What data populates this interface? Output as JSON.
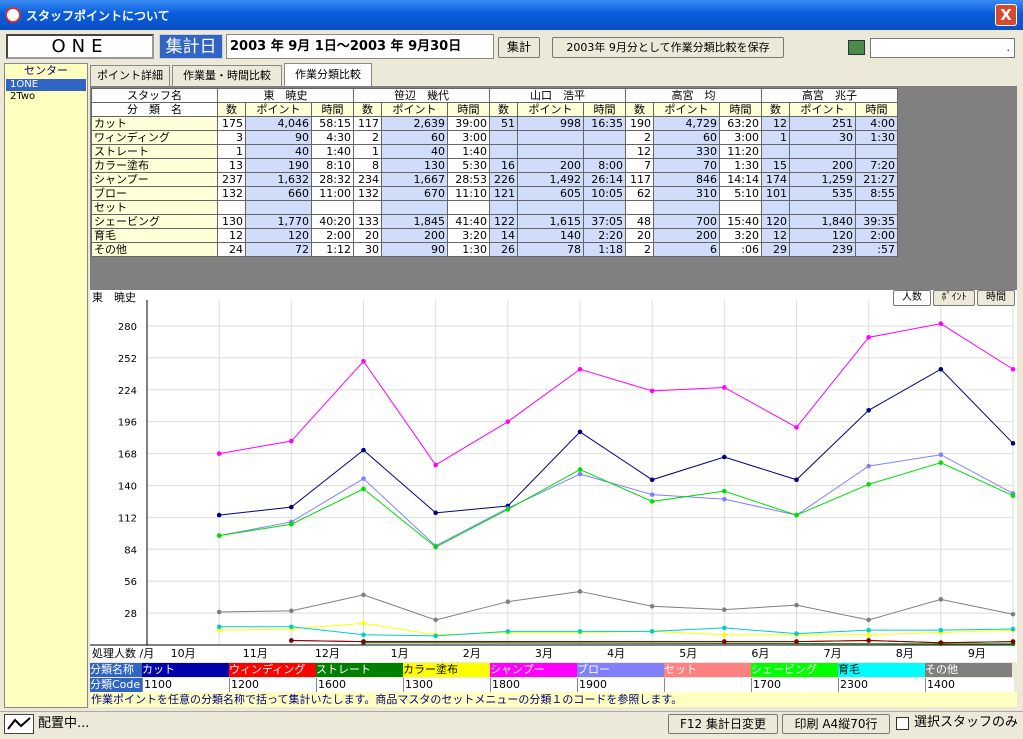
{
  "window": {
    "title": "スタッフポイントについて",
    "close_label": "X"
  },
  "toolbar": {
    "staff_name": "ONE",
    "date_label": "集計日",
    "date_range": "2003 年  9月  1日～2003 年  9月30日",
    "aggregate_label": "集計",
    "save_label": "2003年 9月分として作業分類比較を保存",
    "calc_value": "."
  },
  "sidebar": {
    "header": "センター",
    "items": [
      {
        "label": "1ONE",
        "selected": true
      },
      {
        "label": "2Two",
        "selected": false
      }
    ]
  },
  "tabs": [
    {
      "label": "ポイント詳細",
      "active": false
    },
    {
      "label": "作業量・時間比較",
      "active": false
    },
    {
      "label": "作業分類比較",
      "active": true
    }
  ],
  "table": {
    "corner_top": "スタッフ名",
    "corner_bottom": "分　類　名",
    "subcols": [
      "数",
      "ポイント",
      "時間"
    ],
    "staff": [
      "東　暁史",
      "笹辺　幾代",
      "山口　浩平",
      "高宮　均",
      "高宮　兆子"
    ],
    "rows": [
      {
        "name": "カット",
        "cells": [
          [
            "175",
            "4,046",
            "58:15"
          ],
          [
            "117",
            "2,639",
            "39:00"
          ],
          [
            "51",
            "998",
            "16:35"
          ],
          [
            "190",
            "4,729",
            "63:20"
          ],
          [
            "12",
            "251",
            "4:00"
          ]
        ]
      },
      {
        "name": "ワィンディング",
        "cells": [
          [
            "3",
            "90",
            "4:30"
          ],
          [
            "2",
            "60",
            "3:00"
          ],
          [
            "",
            "",
            ""
          ],
          [
            "2",
            "60",
            "3:00"
          ],
          [
            "1",
            "30",
            "1:30"
          ]
        ]
      },
      {
        "name": "ストレート",
        "cells": [
          [
            "1",
            "40",
            "1:40"
          ],
          [
            "1",
            "40",
            "1:40"
          ],
          [
            "",
            "",
            ""
          ],
          [
            "12",
            "330",
            "11:20"
          ],
          [
            "",
            "",
            ""
          ]
        ]
      },
      {
        "name": "カラー塗布",
        "cells": [
          [
            "13",
            "190",
            "8:10"
          ],
          [
            "8",
            "130",
            "5:30"
          ],
          [
            "16",
            "200",
            "8:00"
          ],
          [
            "7",
            "70",
            "1:30"
          ],
          [
            "15",
            "200",
            "7:20"
          ]
        ]
      },
      {
        "name": "シャンプー",
        "cells": [
          [
            "237",
            "1,632",
            "28:32"
          ],
          [
            "234",
            "1,667",
            "28:53"
          ],
          [
            "226",
            "1,492",
            "26:14"
          ],
          [
            "117",
            "846",
            "14:14"
          ],
          [
            "174",
            "1,259",
            "21:27"
          ]
        ]
      },
      {
        "name": "ブロー",
        "cells": [
          [
            "132",
            "660",
            "11:00"
          ],
          [
            "132",
            "670",
            "11:10"
          ],
          [
            "121",
            "605",
            "10:05"
          ],
          [
            "62",
            "310",
            "5:10"
          ],
          [
            "101",
            "535",
            "8:55"
          ]
        ]
      },
      {
        "name": "セット",
        "cells": [
          [
            "",
            "",
            ""
          ],
          [
            "",
            "",
            ""
          ],
          [
            "",
            "",
            ""
          ],
          [
            "",
            "",
            ""
          ],
          [
            "",
            "",
            ""
          ]
        ]
      },
      {
        "name": "シェービング",
        "cells": [
          [
            "130",
            "1,770",
            "40:20"
          ],
          [
            "133",
            "1,845",
            "41:40"
          ],
          [
            "122",
            "1,615",
            "37:05"
          ],
          [
            "48",
            "700",
            "15:40"
          ],
          [
            "120",
            "1,840",
            "39:35"
          ]
        ]
      },
      {
        "name": "育毛",
        "cells": [
          [
            "12",
            "120",
            "2:00"
          ],
          [
            "20",
            "200",
            "3:20"
          ],
          [
            "14",
            "140",
            "2:20"
          ],
          [
            "20",
            "200",
            "3:20"
          ],
          [
            "12",
            "120",
            "2:00"
          ]
        ]
      },
      {
        "name": "その他",
        "cells": [
          [
            "24",
            "72",
            "1:12"
          ],
          [
            "30",
            "90",
            "1:30"
          ],
          [
            "26",
            "78",
            "1:18"
          ],
          [
            "2",
            "6",
            ":06"
          ],
          [
            "29",
            "239",
            ":57"
          ]
        ]
      }
    ]
  },
  "chart_buttons": [
    {
      "label": "人数",
      "active": true
    },
    {
      "label": "ﾎﾟｲﾝﾄ",
      "active": false
    },
    {
      "label": "時間",
      "active": false
    }
  ],
  "chart_data": {
    "type": "line",
    "title": "東　暁史",
    "xlabel": "処理人数 /月",
    "ylabel": "",
    "categories": [
      "10月",
      "11月",
      "12月",
      "1月",
      "2月",
      "3月",
      "4月",
      "5月",
      "6月",
      "7月",
      "8月",
      "9月"
    ],
    "yticks": [
      28,
      56,
      84,
      112,
      140,
      168,
      196,
      224,
      252,
      280
    ],
    "ylim": [
      0,
      294
    ],
    "grid": true,
    "series": [
      {
        "name": "カット",
        "color": "#000080",
        "values": [
          null,
          114,
          121,
          171,
          116,
          122,
          187,
          145,
          165,
          145,
          206,
          242,
          177
        ]
      },
      {
        "name": "ウィンディング",
        "color": "#ff0000",
        "values": [
          null,
          null,
          4,
          3,
          null,
          null,
          null,
          null,
          3,
          3,
          4,
          2,
          3
        ]
      },
      {
        "name": "ストレート",
        "color": "#008000",
        "values": [
          null,
          null,
          null,
          2,
          null,
          null,
          null,
          null,
          null,
          null,
          null,
          1,
          1
        ]
      },
      {
        "name": "カラー塗布",
        "color": "#ffff00",
        "values": [
          null,
          13,
          14,
          19,
          9,
          11,
          11,
          12,
          9,
          9,
          9,
          11,
          13
        ]
      },
      {
        "name": "シャンプー",
        "color": "#ff00ff",
        "values": [
          null,
          168,
          179,
          249,
          158,
          196,
          242,
          223,
          226,
          191,
          270,
          282,
          242
        ]
      },
      {
        "name": "ブロー",
        "color": "#8080ff",
        "values": [
          null,
          96,
          108,
          146,
          87,
          120,
          150,
          132,
          128,
          114,
          157,
          167,
          133
        ]
      },
      {
        "name": "セット",
        "color": "#ff8080",
        "values": [
          null,
          null,
          null,
          null,
          null,
          null,
          null,
          null,
          null,
          null,
          null,
          null,
          null
        ]
      },
      {
        "name": "シェービング",
        "color": "#00dd00",
        "values": [
          null,
          96,
          106,
          137,
          86,
          119,
          154,
          126,
          135,
          114,
          141,
          160,
          131
        ]
      },
      {
        "name": "育毛",
        "color": "#00cccc",
        "values": [
          null,
          16,
          16,
          9,
          8,
          12,
          12,
          12,
          15,
          10,
          13,
          13,
          14
        ]
      },
      {
        "name": "その他",
        "color": "#808080",
        "values": [
          null,
          29,
          30,
          44,
          22,
          38,
          47,
          34,
          31,
          35,
          22,
          40,
          27
        ]
      },
      {
        "name": "",
        "color": "#800000",
        "values": [
          null,
          null,
          4,
          3,
          null,
          null,
          null,
          null,
          3,
          3,
          4,
          2,
          3
        ]
      }
    ]
  },
  "legend": {
    "name_label": "分類名称",
    "code_label": "分類Code",
    "entries": [
      {
        "name": "カット",
        "code": "1100",
        "color": "#0000aa",
        "text_color": "#ffffff"
      },
      {
        "name": "ウィンディング",
        "code": "1200",
        "color": "#ff0000",
        "text_color": "#ffffff"
      },
      {
        "name": "ストレート",
        "code": "1600",
        "color": "#008000",
        "text_color": "#ffffff"
      },
      {
        "name": "カラー塗布",
        "code": "1300",
        "color": "#ffff00",
        "text_color": "#000000"
      },
      {
        "name": "シャンプー",
        "code": "1800",
        "color": "#ff00ff",
        "text_color": "#ffffff"
      },
      {
        "name": "ブロー",
        "code": "1900",
        "color": "#8080ff",
        "text_color": "#ffffff"
      },
      {
        "name": "セット",
        "code": "",
        "color": "#ff8080",
        "text_color": "#ffffff"
      },
      {
        "name": "シェービング",
        "code": "1700",
        "color": "#00ff00",
        "text_color": "#ffffff"
      },
      {
        "name": "育毛",
        "code": "2300",
        "color": "#00ffff",
        "text_color": "#000000"
      },
      {
        "name": "その他",
        "code": "1400",
        "color": "#808080",
        "text_color": "#ffffff"
      }
    ]
  },
  "note": "作業ポイントを任意の分類名称で括って集計いたします。商品マスタのセットメニューの分類１のコードを参照します。",
  "status": {
    "text": "配置中...",
    "f12_label": "F12 集計日変更",
    "print_label": "印刷 A4縦70行",
    "selected_only_label": "選択スタッフのみ"
  }
}
